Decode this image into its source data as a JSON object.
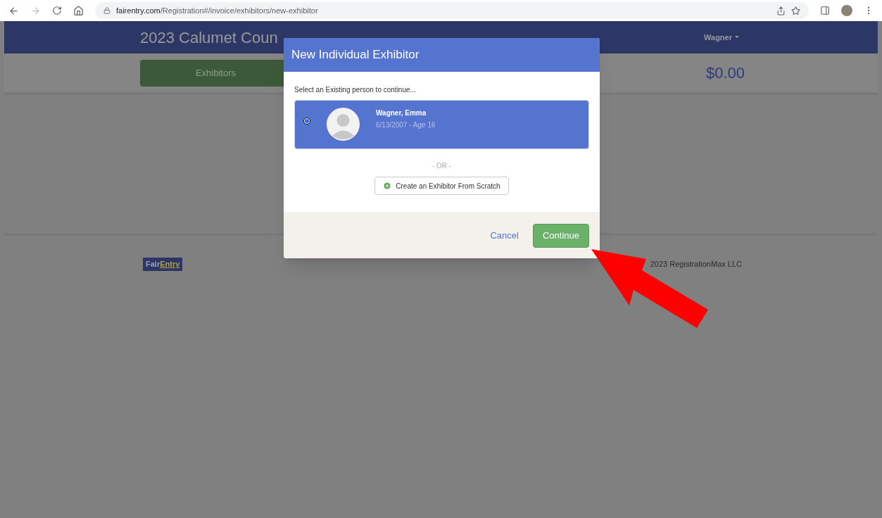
{
  "browser": {
    "url_host": "fairentry.com",
    "url_path": "/Registration#/invoice/exhibitors/new-exhibitor"
  },
  "header": {
    "title": "2023 Calumet Coun",
    "user": "Wagner"
  },
  "toolbar": {
    "tab": "Exhibitors",
    "total": "$0.00"
  },
  "footer": {
    "copyright": "2023 RegistrationMax LLC",
    "logo": {
      "part_1": "Fair",
      "part_2": "Entry"
    }
  },
  "modal": {
    "title": "New Individual Exhibitor",
    "prompt": "Select an Existing person to continue...",
    "people": [
      {
        "name": "Wagner, Emma",
        "detail": "6/13/2007 - Age 16",
        "selected": true
      }
    ],
    "separator": "- OR -",
    "create_button": "Create an Exhibitor From Scratch",
    "cancel": "Cancel",
    "continue": "Continue"
  }
}
